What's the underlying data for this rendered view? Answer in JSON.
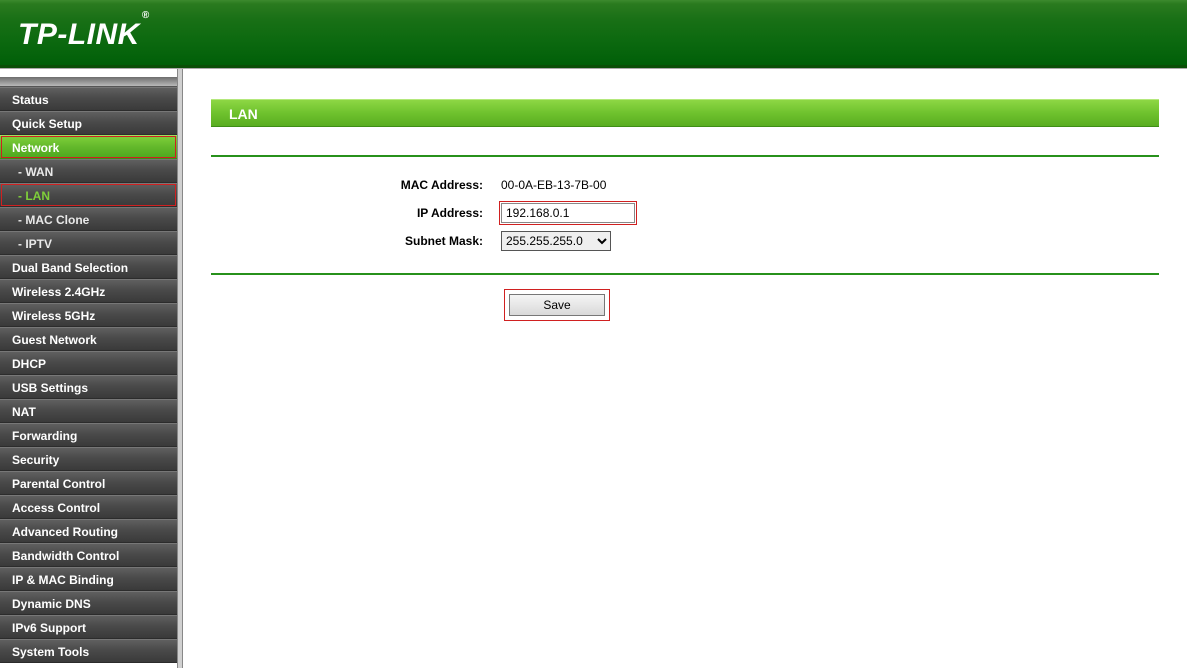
{
  "brand": "TP-LINK",
  "reg": "®",
  "sidebar": {
    "items": [
      {
        "label": "Status",
        "type": "top"
      },
      {
        "label": "Quick Setup",
        "type": "top"
      },
      {
        "label": "Network",
        "type": "top",
        "active": true,
        "hl": true
      },
      {
        "label": "- WAN",
        "type": "sub"
      },
      {
        "label": "- LAN",
        "type": "sub",
        "activesub": true,
        "hl": true
      },
      {
        "label": "- MAC Clone",
        "type": "sub"
      },
      {
        "label": "- IPTV",
        "type": "sub"
      },
      {
        "label": "Dual Band Selection",
        "type": "top"
      },
      {
        "label": "Wireless 2.4GHz",
        "type": "top"
      },
      {
        "label": "Wireless 5GHz",
        "type": "top"
      },
      {
        "label": "Guest Network",
        "type": "top"
      },
      {
        "label": "DHCP",
        "type": "top"
      },
      {
        "label": "USB Settings",
        "type": "top"
      },
      {
        "label": "NAT",
        "type": "top"
      },
      {
        "label": "Forwarding",
        "type": "top"
      },
      {
        "label": "Security",
        "type": "top"
      },
      {
        "label": "Parental Control",
        "type": "top"
      },
      {
        "label": "Access Control",
        "type": "top"
      },
      {
        "label": "Advanced Routing",
        "type": "top"
      },
      {
        "label": "Bandwidth Control",
        "type": "top"
      },
      {
        "label": "IP & MAC Binding",
        "type": "top"
      },
      {
        "label": "Dynamic DNS",
        "type": "top"
      },
      {
        "label": "IPv6 Support",
        "type": "top"
      },
      {
        "label": "System Tools",
        "type": "top"
      }
    ]
  },
  "panel": {
    "title": "LAN",
    "mac_label": "MAC Address:",
    "mac_value": "00-0A-EB-13-7B-00",
    "ip_label": "IP Address:",
    "ip_value": "192.168.0.1",
    "mask_label": "Subnet Mask:",
    "mask_value": "255.255.255.0",
    "save": "Save"
  }
}
